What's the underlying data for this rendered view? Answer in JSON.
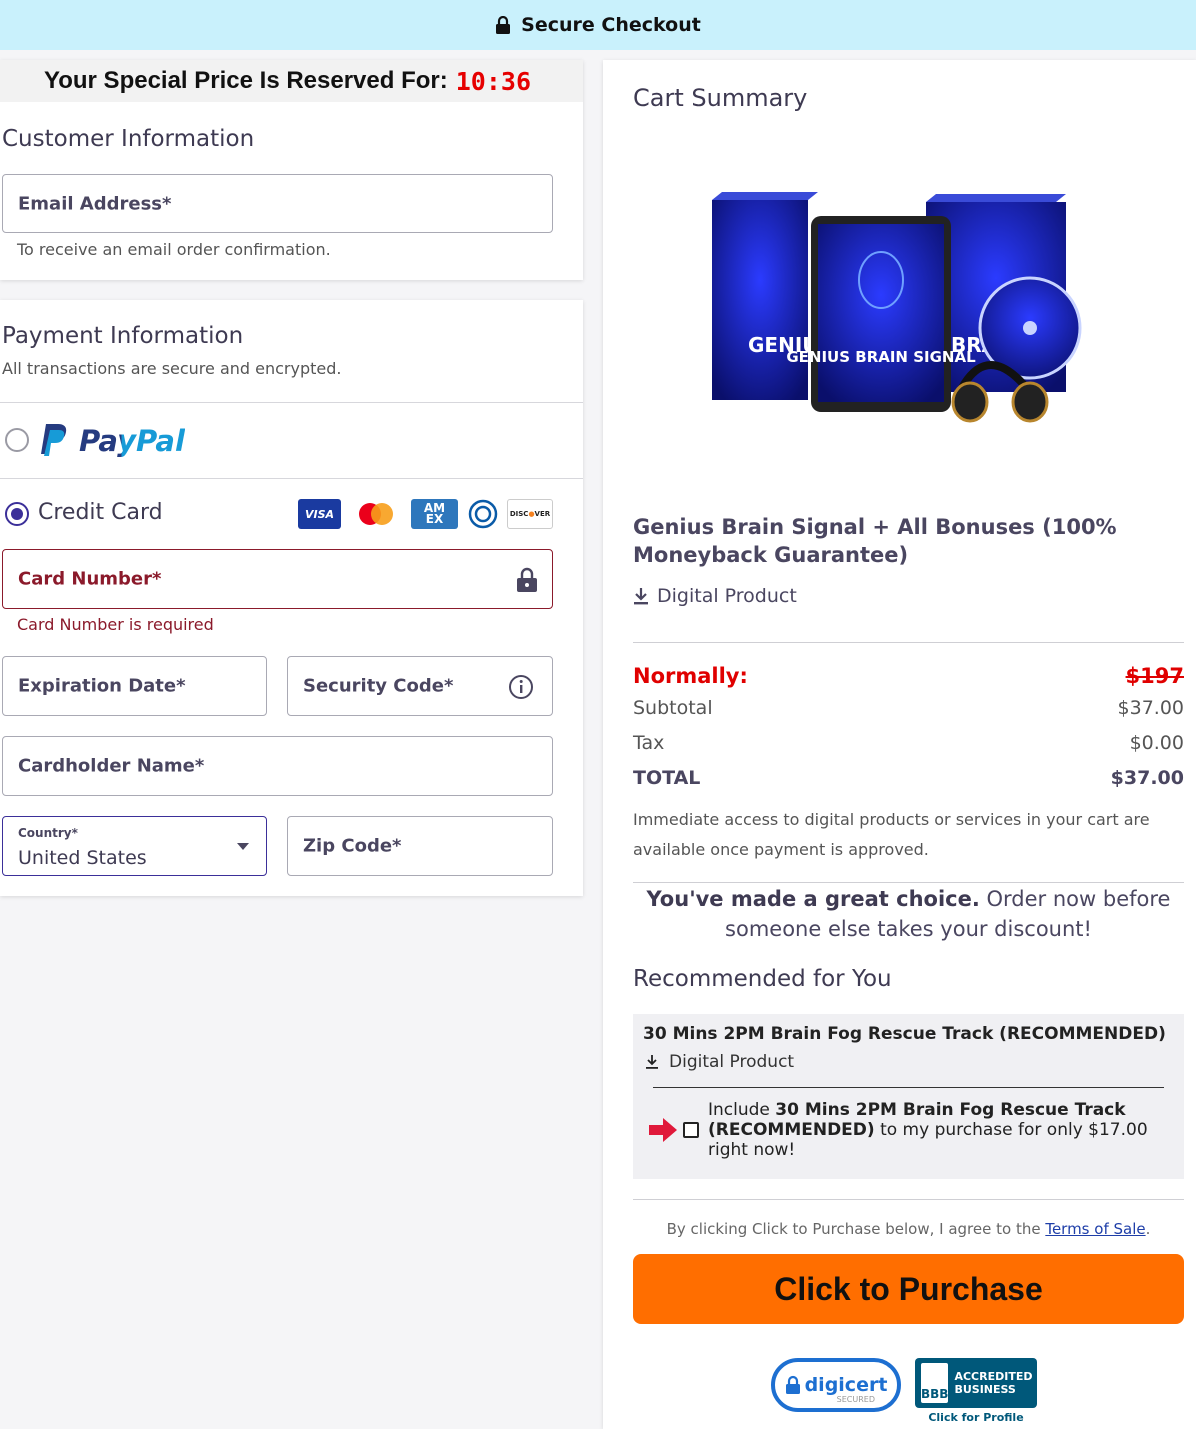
{
  "topbar": {
    "title": "Secure Checkout"
  },
  "timer": {
    "label": "Your Special Price Is Reserved For:",
    "time": "10:36"
  },
  "customer": {
    "title": "Customer Information",
    "email_label": "Email Address*",
    "email_hint": "To receive an email order confirmation."
  },
  "payment": {
    "title": "Payment Information",
    "subtitle": "All transactions are secure and encrypted.",
    "paypal_label": "PayPal",
    "credit_card_label": "Credit Card",
    "card_logos": [
      "VISA",
      "mastercard",
      "AMEX",
      "diners",
      "DISCOVER"
    ],
    "card_number_label": "Card Number*",
    "card_number_error": "Card Number is required",
    "expiration_label": "Expiration Date*",
    "security_label": "Security Code*",
    "cardholder_label": "Cardholder Name*",
    "country_label": "Country*",
    "country_value": "United States",
    "zip_label": "Zip Code*"
  },
  "cart": {
    "title": "Cart Summary",
    "product_image_text": "GENIUS BRAIN SIGNAL",
    "product_image_side_left": "GENIUS",
    "product_image_side_right": "BRA",
    "product_name": "Genius Brain Signal + All Bonuses (100% Moneyback Guarantee)",
    "product_type": "Digital Product",
    "normally_label": "Normally:",
    "normally_value": "$197",
    "subtotal_label": "Subtotal",
    "subtotal_value": "$37.00",
    "tax_label": "Tax",
    "tax_value": "$0.00",
    "total_label": "TOTAL",
    "total_value": "$37.00",
    "access_note": "Immediate access to digital products or services in your cart are available once payment is approved.",
    "great_bold": "You've made a great choice.",
    "great_rest": " Order now before someone else takes your discount!"
  },
  "recommended": {
    "title": "Recommended for You",
    "item_name": "30 Mins 2PM Brain Fog Rescue Track (RECOMMENDED)",
    "item_type": "Digital Product",
    "include_prefix": "Include ",
    "include_bold": "30 Mins 2PM Brain Fog Rescue Track (RECOMMENDED)",
    "include_suffix": " to my purchase for only $17.00 right now!"
  },
  "purchase": {
    "terms_prefix": "By clicking Click to Purchase below, I agree to the ",
    "terms_link": "Terms of Sale",
    "terms_suffix": ".",
    "button_label": "Click to Purchase"
  },
  "badges": {
    "digicert": "digicert",
    "digicert_sub": "SECURED",
    "bbb_logo": "BBB",
    "bbb_line1": "ACCREDITED",
    "bbb_line2": "BUSINESS",
    "bbb_caption": "Click for Profile"
  },
  "colors": {
    "accent": "#3b2f99",
    "error": "#8b1a2b",
    "button": "#ff6e00",
    "banner": "#c9f1fc",
    "price_red": "#e00000"
  }
}
